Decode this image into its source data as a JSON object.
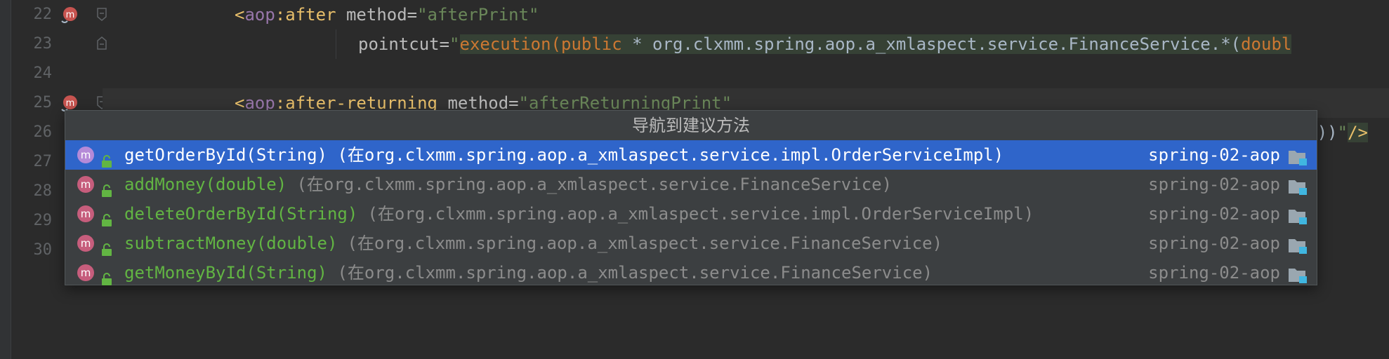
{
  "gutter": {
    "line_numbers": [
      "22",
      "23",
      "24",
      "25",
      "26",
      "27",
      "28",
      "29",
      "30"
    ]
  },
  "code": {
    "line22": {
      "open": "<",
      "ns": "aop",
      "colon": ":",
      "tag": "after",
      "attr": " method=",
      "value": "\"afterPrint\""
    },
    "line23": {
      "attr": "pointcut=",
      "q": "\"",
      "fn": "execution(",
      "kw": "public",
      "rest": " * org.clxmm.spring.aop.a_xmlaspect.service.FinanceService.*(",
      "cut": "doubl"
    },
    "line25": {
      "open": "<",
      "ns": "aop",
      "colon": ":",
      "tag": "after-returning",
      "attr": " method=",
      "value": "\"afterReturningPrint\""
    },
    "line26_tail": {
      "paren": "))",
      "quote": "\"",
      "close": "/>"
    }
  },
  "popup": {
    "title": "导航到建议方法",
    "items": [
      {
        "name": "getOrderById(String)",
        "location": " (在org.clxmm.spring.aop.a_xmlaspect.service.impl.OrderServiceImpl)",
        "module": "spring-02-aop",
        "selected": true
      },
      {
        "name": "addMoney(double)",
        "location": " (在org.clxmm.spring.aop.a_xmlaspect.service.FinanceService)",
        "module": "spring-02-aop",
        "selected": false
      },
      {
        "name": "deleteOrderById(String)",
        "location": " (在org.clxmm.spring.aop.a_xmlaspect.service.impl.OrderServiceImpl)",
        "module": "spring-02-aop",
        "selected": false
      },
      {
        "name": "subtractMoney(double)",
        "location": " (在org.clxmm.spring.aop.a_xmlaspect.service.FinanceService)",
        "module": "spring-02-aop",
        "selected": false
      },
      {
        "name": "getMoneyById(String)",
        "location": " (在org.clxmm.spring.aop.a_xmlaspect.service.FinanceService)",
        "module": "spring-02-aop",
        "selected": false
      }
    ],
    "method_icon_letter": "m"
  },
  "icons": {
    "gutter_advice": "aspect-navigate-icon",
    "method": "method-icon",
    "visibility": "public-lock-icon",
    "module": "module-folder-icon"
  },
  "colors": {
    "selection": "#2f65ca",
    "method_name": "#62b543",
    "tag": "#e8bf6a",
    "string": "#6a8759",
    "keyword": "#cc7832"
  }
}
